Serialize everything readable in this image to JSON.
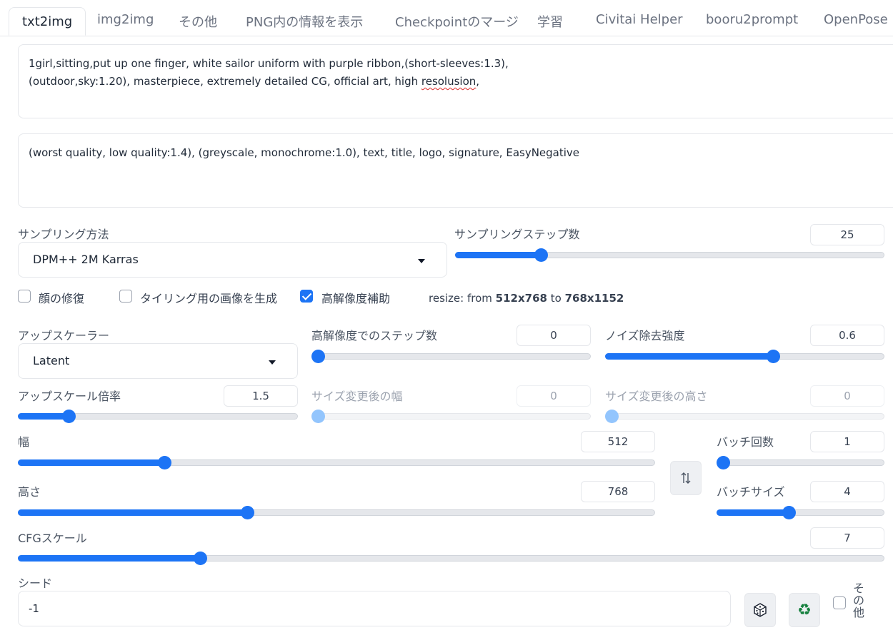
{
  "tabs": [
    "txt2img",
    "img2img",
    "その他",
    "PNG内の情報を表示",
    "Checkpointのマージ",
    "学習",
    "Civitai Helper",
    "booru2prompt",
    "OpenPose E"
  ],
  "prompt": {
    "line1": "1girl,sitting,put up one finger, white sailor uniform with purple ribbon,(short-sleeves:1.3),",
    "line2_prefix": "(outdoor,sky:1.20), masterpiece, extremely detailed CG, official art, high ",
    "line2_misspelled": "resolusion",
    "line2_suffix": ","
  },
  "negative_prompt": "(worst quality, low quality:1.4), (greyscale, monochrome:1.0), text, title, logo, signature,  EasyNegative",
  "sampling": {
    "method_label": "サンプリング方法",
    "method_value": "DPM++ 2M Karras",
    "steps_label": "サンプリングステップ数",
    "steps_value": "25",
    "steps_fraction": 0.2
  },
  "checks": {
    "face_restore": "顔の修復",
    "face_restore_checked": false,
    "tiling": "タイリング用の画像を生成",
    "tiling_checked": false,
    "hires_fix": "高解像度補助",
    "hires_fix_checked": true
  },
  "resize_info": {
    "prefix": "resize: from ",
    "from": "512x768",
    "mid": " to ",
    "to": "768x1152"
  },
  "hires": {
    "upscaler_label": "アップスケーラー",
    "upscaler_value": "Latent",
    "steps_label": "高解像度でのステップ数",
    "steps_value": "0",
    "steps_fraction": 0.0,
    "denoise_label": "ノイズ除去強度",
    "denoise_value": "0.6",
    "denoise_fraction": 0.6,
    "scale_label": "アップスケール倍率",
    "scale_value": "1.5",
    "scale_fraction": 0.18,
    "resize_w_label": "サイズ変更後の幅",
    "resize_w_value": "0",
    "resize_w_fraction": 0.0,
    "resize_h_label": "サイズ変更後の高さ",
    "resize_h_value": "0",
    "resize_h_fraction": 0.0
  },
  "size": {
    "width_label": "幅",
    "width_value": "512",
    "width_fraction": 0.23,
    "height_label": "高さ",
    "height_value": "768",
    "height_fraction": 0.36,
    "swap_icon": "swap-vertical-icon"
  },
  "batch": {
    "count_label": "バッチ回数",
    "count_value": "1",
    "count_fraction": 0.0,
    "size_label": "バッチサイズ",
    "size_value": "4",
    "size_fraction": 0.43
  },
  "cfg": {
    "label": "CFGスケール",
    "value": "7",
    "fraction": 0.21
  },
  "seed": {
    "label": "シード",
    "value": "-1",
    "dice_icon": "dice-icon",
    "recycle_icon": "recycle-icon",
    "extra_label_chars": [
      "そ",
      "の",
      "他"
    ],
    "extra_checked": false
  },
  "colors": {
    "accent": "#1d74f5",
    "accent_disabled": "#93c5fd",
    "border": "#e5e7eb",
    "misspell": "#dc2626"
  }
}
